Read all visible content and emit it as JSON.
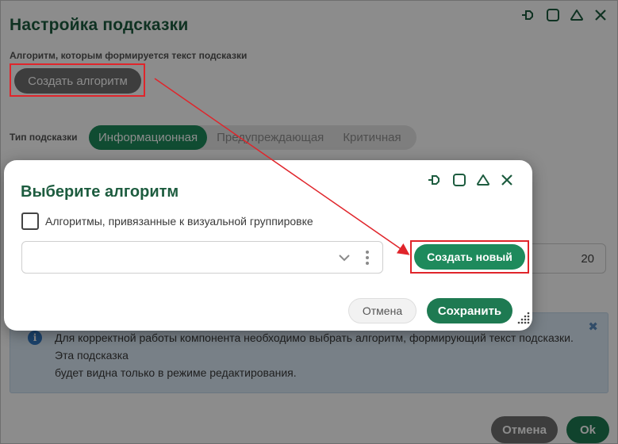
{
  "background_dialog": {
    "title": "Настройка подсказки",
    "algorithm_label": "Алгоритм, которым формируется текст подсказки",
    "create_algorithm_button": "Создать алгоритм",
    "hint_type_label": "Тип подсказки",
    "hint_types": [
      {
        "label": "Информационная",
        "active": true
      },
      {
        "label": "Предупреждающая",
        "active": false
      },
      {
        "label": "Критичная",
        "active": false
      }
    ],
    "number_value": "20",
    "info_message": "Для корректной работы компонента необходимо выбрать алгоритм, формирующий текст подсказки. Эта подсказка",
    "info_message_line2": "будет видна только в режиме редактирования.",
    "cancel_button": "Отмена",
    "ok_button": "Ok"
  },
  "modal": {
    "title": "Выберите алгоритм",
    "checkbox_label": "Алгоритмы, привязанные к визуальной группировке",
    "checkbox_checked": false,
    "select_value": "",
    "create_new_button": "Создать новый",
    "cancel_button": "Отмена",
    "save_button": "Сохранить"
  },
  "colors": {
    "accent_green": "#1e8a5c",
    "title_green": "#1d5c3f",
    "highlight_red": "#e0252b",
    "info_bg": "#dbe9f6"
  },
  "icons": {
    "window_controls": [
      "pin-icon",
      "maximize-icon",
      "collapse-icon",
      "close-icon"
    ],
    "info": "info-icon",
    "select": [
      "chevron-down-icon",
      "kebab-menu-icon"
    ],
    "resize": "resize-grip-icon"
  }
}
